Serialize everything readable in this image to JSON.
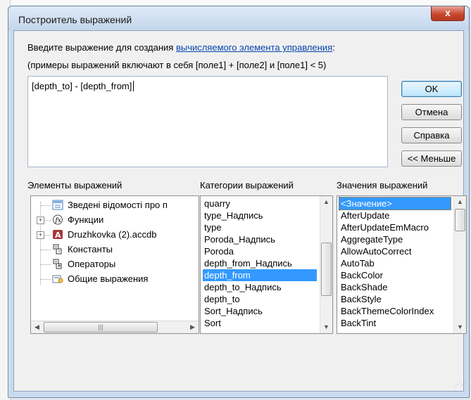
{
  "window": {
    "title": "Построитель выражений",
    "close_label": "x"
  },
  "intro": {
    "line1_prefix": "Введите выражение для создания ",
    "line1_link": "вычисляемого элемента управления",
    "line1_suffix": ":",
    "line2": "(примеры выражений включают в себя [поле1] + [поле2] и [поле1] < 5)"
  },
  "expression": {
    "value": "[depth_to] - [depth_from]"
  },
  "buttons": {
    "ok": "OK",
    "cancel": "Отмена",
    "help": "Справка",
    "less": "<< Меньше"
  },
  "sections": {
    "elements": "Элементы выражений",
    "categories": "Категории выражений",
    "values": "Значения выражений"
  },
  "elements_tree": [
    {
      "label": "Зведені відомості про п",
      "icon": "form-icon"
    },
    {
      "label": "Функции",
      "icon": "function-icon"
    },
    {
      "label": "Druzhkovka (2).accdb",
      "icon": "database-icon"
    },
    {
      "label": "Константы",
      "icon": "constants-icon"
    },
    {
      "label": "Операторы",
      "icon": "operators-icon"
    },
    {
      "label": "Общие выражения",
      "icon": "common-expressions-icon"
    }
  ],
  "categories_list": [
    "quarry",
    "type_Надпись",
    "type",
    "Poroda_Надпись",
    "Poroda",
    "depth_from_Надпись",
    "depth_from",
    "depth_to_Надпись",
    "depth_to",
    "Sort_Надпись",
    "Sort"
  ],
  "categories_selected": "depth_from",
  "values_list": [
    "<Значение>",
    "AfterUpdate",
    "AfterUpdateEmMacro",
    "AggregateType",
    "AllowAutoCorrect",
    "AutoTab",
    "BackColor",
    "BackShade",
    "BackStyle",
    "BackThemeColorIndex",
    "BackTint"
  ],
  "values_selected": "<Значение>",
  "colors": {
    "selection": "#3399ff",
    "link": "#0645ad",
    "close_button": "#c7432b"
  }
}
